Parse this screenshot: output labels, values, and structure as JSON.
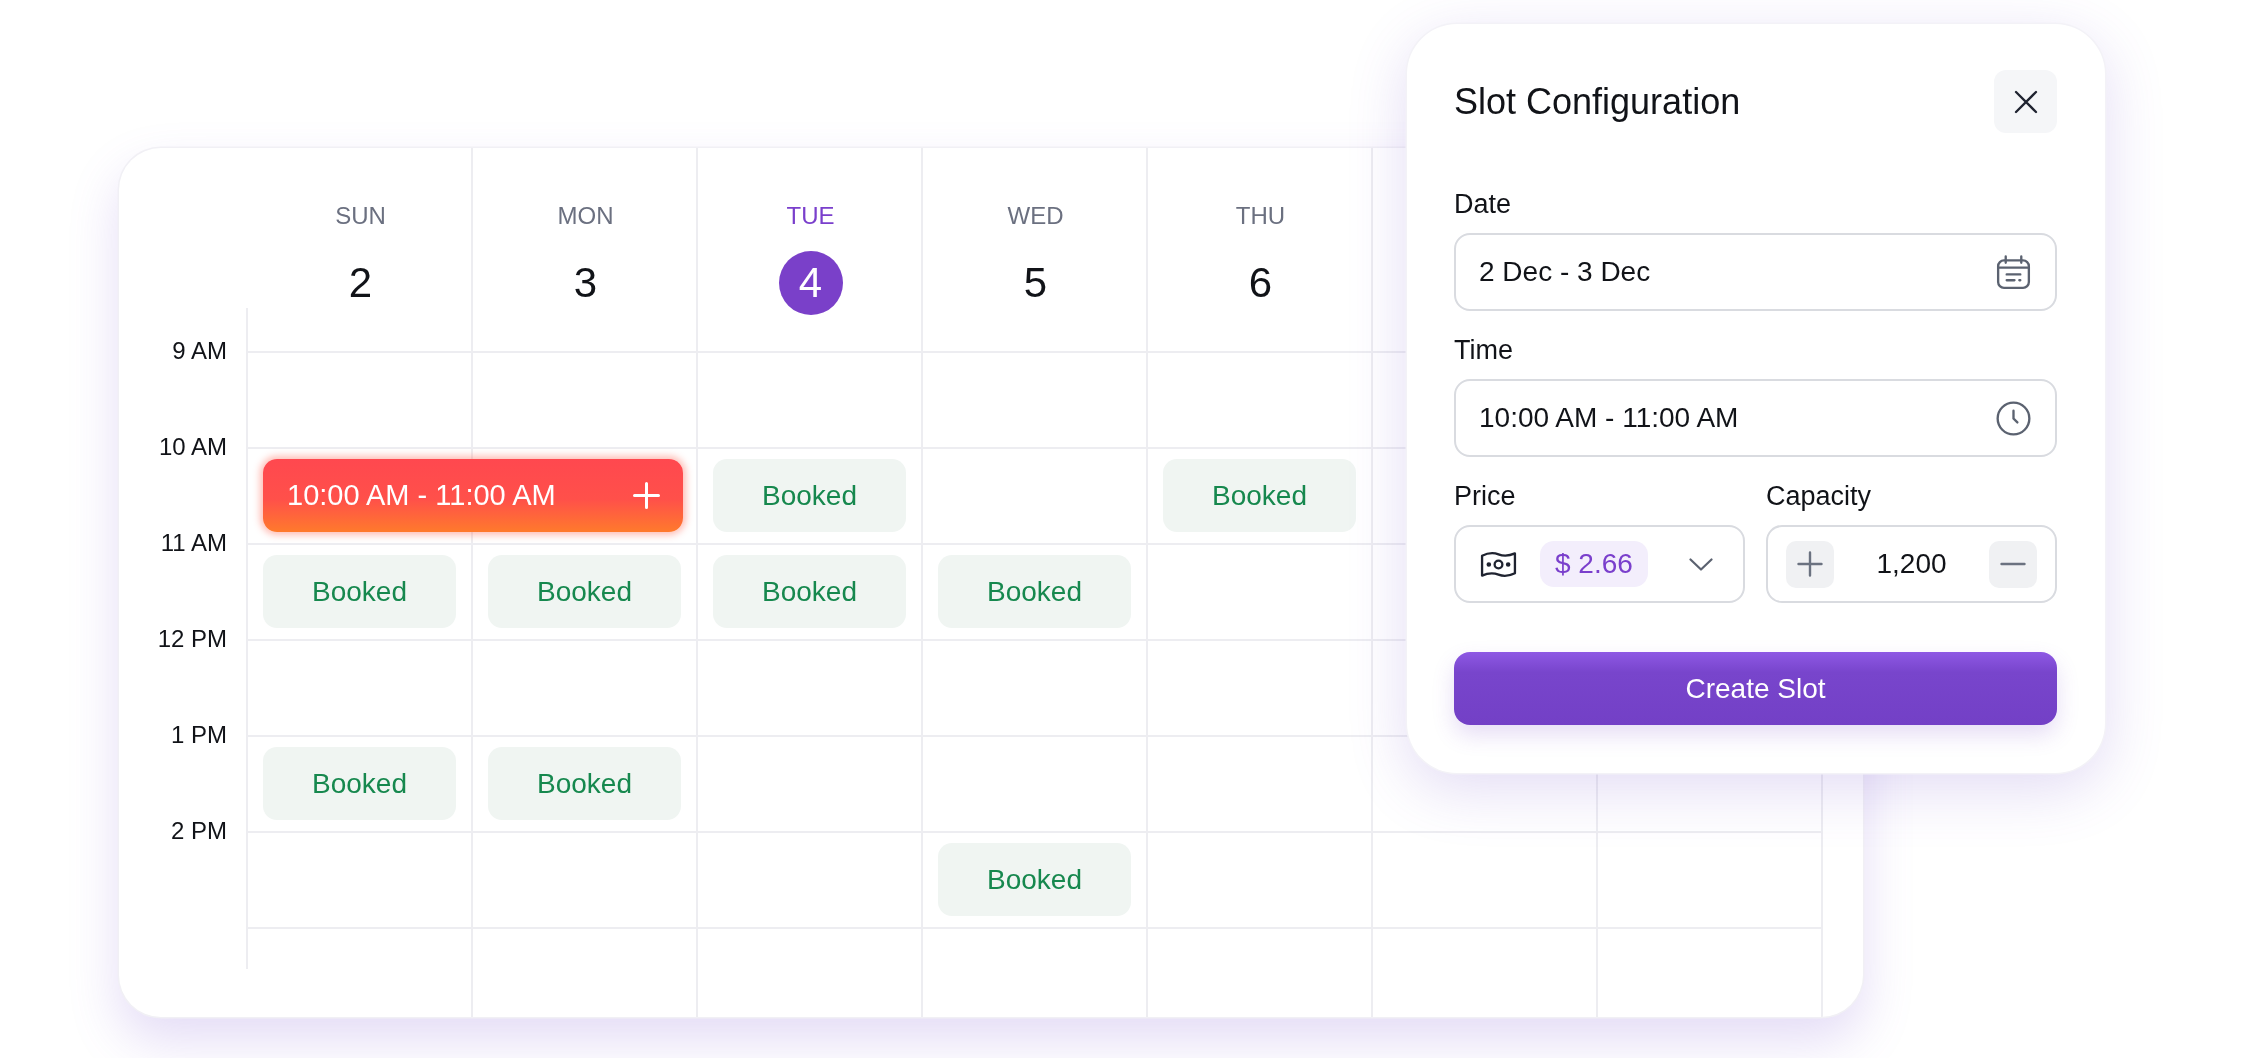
{
  "calendar": {
    "days": [
      {
        "name": "SUN",
        "date": "2",
        "selected": false
      },
      {
        "name": "MON",
        "date": "3",
        "selected": false
      },
      {
        "name": "TUE",
        "date": "4",
        "selected": true
      },
      {
        "name": "WED",
        "date": "5",
        "selected": false
      },
      {
        "name": "THU",
        "date": "6",
        "selected": false
      }
    ],
    "rows": [
      {
        "time": "9 AM",
        "cells": [
          {
            "kind": "free"
          },
          {
            "kind": "free"
          },
          {
            "kind": "free"
          },
          {
            "kind": "free"
          },
          {
            "kind": "free"
          },
          {
            "kind": "free"
          },
          {
            "kind": "free"
          }
        ]
      },
      {
        "time": "10 AM",
        "cells": [
          {
            "kind": "new_slot",
            "label": "10:00 AM - 11:00 AM"
          },
          {
            "kind": "continued"
          },
          {
            "kind": "booked",
            "label": "Booked"
          },
          {
            "kind": "free"
          },
          {
            "kind": "booked",
            "label": "Booked"
          },
          {
            "kind": "free"
          },
          {
            "kind": "free"
          }
        ]
      },
      {
        "time": "11 AM",
        "cells": [
          {
            "kind": "booked",
            "label": "Booked"
          },
          {
            "kind": "booked",
            "label": "Booked"
          },
          {
            "kind": "booked",
            "label": "Booked"
          },
          {
            "kind": "booked",
            "label": "Booked"
          },
          {
            "kind": "free"
          },
          {
            "kind": "free"
          },
          {
            "kind": "free"
          }
        ]
      },
      {
        "time": "12 PM",
        "cells": [
          {
            "kind": "free"
          },
          {
            "kind": "free"
          },
          {
            "kind": "free"
          },
          {
            "kind": "free"
          },
          {
            "kind": "free"
          },
          {
            "kind": "free"
          },
          {
            "kind": "free"
          }
        ]
      },
      {
        "time": "1 PM",
        "cells": [
          {
            "kind": "booked",
            "label": "Booked"
          },
          {
            "kind": "booked",
            "label": "Booked"
          },
          {
            "kind": "free"
          },
          {
            "kind": "free"
          },
          {
            "kind": "free"
          },
          {
            "kind": "free"
          },
          {
            "kind": "free"
          }
        ]
      },
      {
        "time": "2 PM",
        "cells": [
          {
            "kind": "free"
          },
          {
            "kind": "free"
          },
          {
            "kind": "free"
          },
          {
            "kind": "booked",
            "label": "Booked"
          },
          {
            "kind": "free"
          },
          {
            "kind": "free"
          },
          {
            "kind": "free"
          }
        ]
      }
    ]
  },
  "slot_configuration": {
    "title": "Slot Configuration",
    "date": {
      "label": "Date",
      "value": "2 Dec - 3 Dec"
    },
    "time": {
      "label": "Time",
      "value": "10:00 AM - 11:00 AM"
    },
    "price": {
      "label": "Price",
      "value": "$ 2.66"
    },
    "capacity": {
      "label": "Capacity",
      "value": "1,200"
    },
    "create_button": "Create Slot"
  }
}
